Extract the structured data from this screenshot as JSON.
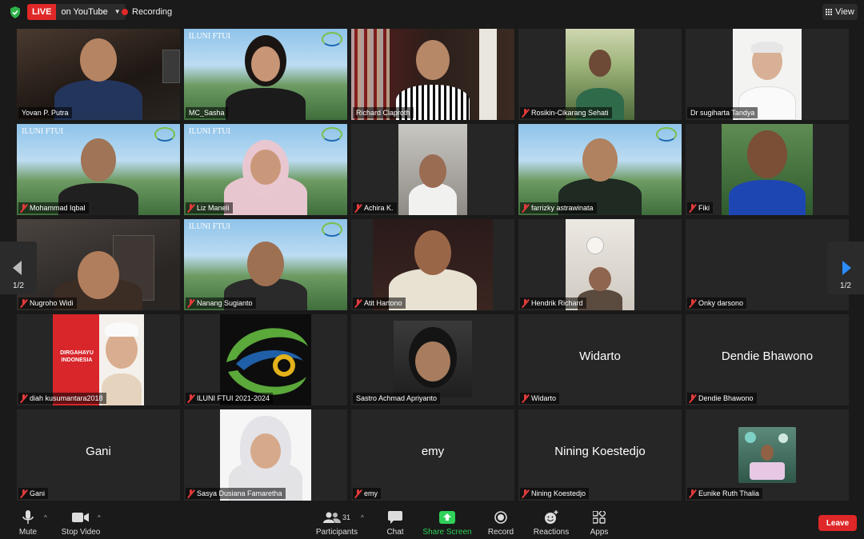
{
  "topbar": {
    "live_label": "LIVE",
    "live_destination": "on YouTube",
    "recording_label": "Recording",
    "view_label": "View"
  },
  "pagination": {
    "left_page": "1/2",
    "right_page": "1/2"
  },
  "participants": [
    {
      "name": "Yovan P. Putra",
      "muted": false,
      "video": true
    },
    {
      "name": "MC_Sasha",
      "muted": false,
      "video": true,
      "active_speaker": true
    },
    {
      "name": "Richard Claproth",
      "muted": false,
      "video": true
    },
    {
      "name": "Rosikin-Cikarang Sehati",
      "muted": true,
      "video": true
    },
    {
      "name": "Dr sugiharta Tandya",
      "muted": false,
      "video": true
    },
    {
      "name": "Mohammad Iqbal",
      "muted": true,
      "video": true
    },
    {
      "name": "Liz Maneli",
      "muted": true,
      "video": true
    },
    {
      "name": "Achira K.",
      "muted": true,
      "video": true
    },
    {
      "name": "farrizky astrawinata",
      "muted": true,
      "video": true
    },
    {
      "name": "Fiki",
      "muted": true,
      "video": true
    },
    {
      "name": "Nugroho Widi",
      "muted": true,
      "video": true
    },
    {
      "name": "Nanang Sugianto",
      "muted": true,
      "video": true
    },
    {
      "name": "Atit Hartono",
      "muted": true,
      "video": true
    },
    {
      "name": "Hendrik Richard",
      "muted": true,
      "video": true
    },
    {
      "name": "Onky darsono",
      "muted": true,
      "video": false
    },
    {
      "name": "diah kusumantara2018",
      "muted": true,
      "video": true,
      "poster_text": "DIRGAHAYU INDONESIA"
    },
    {
      "name": "ILUNI FTUI 2021-2024",
      "muted": true,
      "video": true
    },
    {
      "name": "Sastro Achmad Apriyanto",
      "muted": false,
      "video": true
    },
    {
      "name": "Widarto",
      "muted": true,
      "video": false,
      "display_name": "Widarto"
    },
    {
      "name": "Dendie Bhawono",
      "muted": true,
      "video": false,
      "display_name": "Dendie Bhawono"
    },
    {
      "name": "Gani",
      "muted": true,
      "video": false,
      "display_name": "Gani"
    },
    {
      "name": "Sasya Dusiana Famaretha",
      "muted": true,
      "video": true
    },
    {
      "name": "emy",
      "muted": true,
      "video": false,
      "display_name": "emy"
    },
    {
      "name": "Nining Koestedjo",
      "muted": true,
      "video": false,
      "display_name": "Nining Koestedjo"
    },
    {
      "name": "Eunike Ruth Thalia",
      "muted": true,
      "video": true
    }
  ],
  "toolbar": {
    "mute_label": "Mute",
    "video_label": "Stop Video",
    "participants_label": "Participants",
    "participants_count": "31",
    "chat_label": "Chat",
    "share_label": "Share Screen",
    "record_label": "Record",
    "reactions_label": "Reactions",
    "apps_label": "Apps",
    "leave_label": "Leave"
  },
  "colors": {
    "live_red": "#e02828",
    "active_speaker_outline": "#c9dd3a",
    "share_green": "#30d158",
    "next_arrow_blue": "#2d8cff"
  }
}
